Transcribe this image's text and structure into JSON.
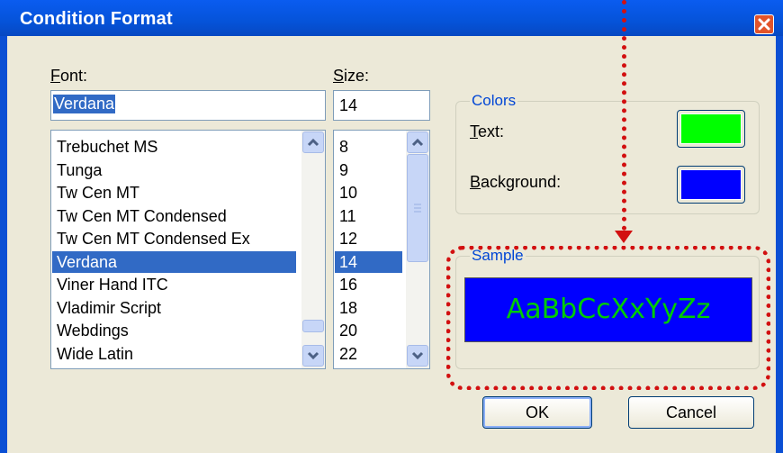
{
  "window": {
    "title": "Condition Format"
  },
  "font": {
    "label": "Font:",
    "value": "Verdana",
    "items": [
      "Trebuchet MS",
      "Tunga",
      "Tw Cen MT",
      "Tw Cen MT Condensed",
      "Tw Cen MT Condensed Ex",
      "Verdana",
      "Viner Hand ITC",
      "Vladimir Script",
      "Webdings",
      "Wide Latin"
    ],
    "selected_index": 5
  },
  "size": {
    "label": "Size:",
    "value": "14",
    "items": [
      "8",
      "9",
      "10",
      "11",
      "12",
      "14",
      "16",
      "18",
      "20",
      "22"
    ],
    "selected_index": 5
  },
  "colors": {
    "group_title": "Colors",
    "text_label": "Text:",
    "background_label": "Background:",
    "text_color": "#00ff00",
    "background_color": "#0000ff"
  },
  "sample": {
    "group_title": "Sample",
    "text": "AaBbCcXxYyZz",
    "text_color": "#00cc00",
    "background_color": "#0000ff"
  },
  "buttons": {
    "ok": "OK",
    "cancel": "Cancel"
  },
  "annotation": {
    "color": "#d21010"
  },
  "icons": {
    "close": "close-icon",
    "scroll_up": "chevron-up-icon",
    "scroll_down": "chevron-down-icon"
  }
}
